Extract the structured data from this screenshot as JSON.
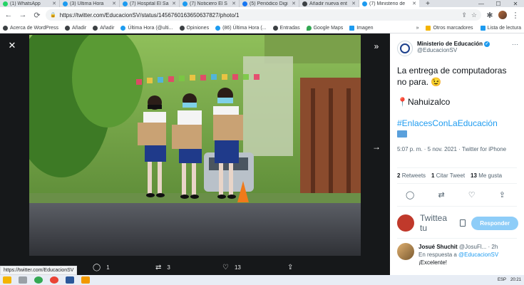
{
  "tabs": [
    {
      "label": "(1) WhatsApp",
      "color": "#25d366"
    },
    {
      "label": "(3) Última Hora",
      "color": "#1d9bf0"
    },
    {
      "label": "(7) Hospital El Sa",
      "color": "#1d9bf0"
    },
    {
      "label": "(7) Noticiero El S",
      "color": "#1d9bf0"
    },
    {
      "label": "(5) Periódico Digi",
      "color": "#1877f2"
    },
    {
      "label": "Añadir nueva ent",
      "color": "#3c4043"
    },
    {
      "label": "(7) Ministerio de",
      "color": "#1d9bf0"
    }
  ],
  "new_tab": "+",
  "window_controls": {
    "minimize": "—",
    "maximize": "☐",
    "close": "✕"
  },
  "toolbar": {
    "back": "←",
    "forward": "→",
    "reload": "⟳",
    "lock": "🔒",
    "url": "https://twitter.com/EducacionSV/status/1456760163650637827/photo/1",
    "share": "⇪",
    "star": "☆",
    "extensions": "✱",
    "menu": "⋮"
  },
  "bookmarks": [
    {
      "label": "Acerca de WordPress",
      "icon": "wp"
    },
    {
      "label": "Añadir",
      "icon": "wp"
    },
    {
      "label": "Añadir",
      "icon": "wp"
    },
    {
      "label": "Última Hora (@ulti...",
      "icon": "tw"
    },
    {
      "label": "Opiniones",
      "icon": "wp"
    },
    {
      "label": "(86) Última Hora (...",
      "icon": "tw"
    },
    {
      "label": "Entradas",
      "icon": "wp"
    },
    {
      "label": "Google Maps",
      "icon": "map"
    },
    {
      "label": "Imagen",
      "icon": "img"
    }
  ],
  "bookmarks_right": [
    {
      "label": "»"
    },
    {
      "label": "Otros marcadores",
      "icon": "folder"
    },
    {
      "label": "Lista de lectura",
      "icon": "img"
    }
  ],
  "viewer": {
    "close": "✕",
    "expand": "»",
    "next": "→",
    "actions": {
      "reply_icon": "◯",
      "reply_count": "1",
      "retweet_icon": "⇄",
      "retweet_count": "3",
      "like_icon": "♡",
      "like_count": "13",
      "share_icon": "⇪"
    }
  },
  "tweet": {
    "display_name": "Ministerio de Educación",
    "verified": "✓",
    "handle": "@EducacionSV",
    "more": "···",
    "text": "La entrega de computadoras no para. 😉",
    "location": "📍Nahuizalco",
    "hashtag": "#EnlacesConLaEducación",
    "meta": "5:07 p. m. · 5 nov. 2021 · Twitter for iPhone",
    "stats": {
      "retweets_count": "2",
      "retweets_label": "Retweets",
      "quotes_count": "1",
      "quotes_label": "Citar Tweet",
      "likes_count": "13",
      "likes_label": "Me gusta"
    },
    "actions": {
      "reply": "◯",
      "retweet": "⇄",
      "like": "♡",
      "share": "⇪"
    }
  },
  "reply_box": {
    "placeholder": "Twittea tu",
    "button": "Responder"
  },
  "comment": {
    "name": "Josué Shuchit",
    "handle": "@JosuFl...",
    "time": "· 2h",
    "in_reply_prefix": "En respuesta a",
    "in_reply_to": "@EducacionSV",
    "text": "¡Excelente!"
  },
  "status_url": "https://twitter.com/EducacionSV",
  "taskbar": {
    "lang": "ESP",
    "time": "20:21"
  }
}
